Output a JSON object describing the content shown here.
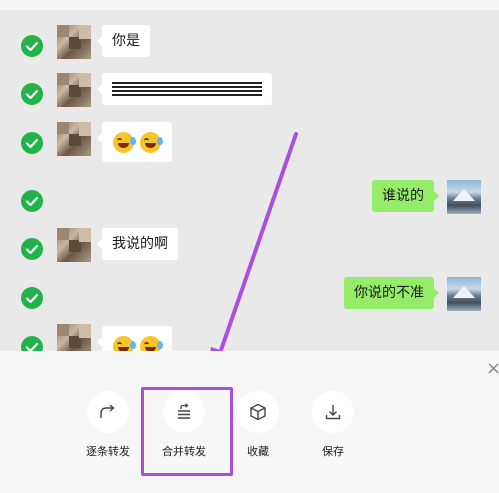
{
  "messages": [
    {
      "side": "left",
      "text": "你是"
    },
    {
      "side": "left",
      "text": "",
      "redacted": true
    },
    {
      "side": "left",
      "emoji": [
        "face-with-tears-emoji",
        "face-with-tears-emoji"
      ]
    },
    {
      "side": "right",
      "text": "谁说的"
    },
    {
      "side": "left",
      "text": "我说的啊"
    },
    {
      "side": "right",
      "text": "你说的不准"
    },
    {
      "side": "left",
      "emoji": [
        "face-with-tears-emoji",
        "face-with-tears-emoji"
      ]
    }
  ],
  "actions": [
    {
      "label": "逐条转发",
      "icon": "forward-icon"
    },
    {
      "label": "合并转发",
      "icon": "merge-forward-icon"
    },
    {
      "label": "收藏",
      "icon": "cube-icon"
    },
    {
      "label": "保存",
      "icon": "download-icon"
    }
  ],
  "close_glyph": "×",
  "colors": {
    "check": "#21b34a",
    "bubble_right": "#95ec69",
    "bubble_left": "#ffffff",
    "chat_bg": "#e9e9e9",
    "highlight": "#a94fdc"
  }
}
